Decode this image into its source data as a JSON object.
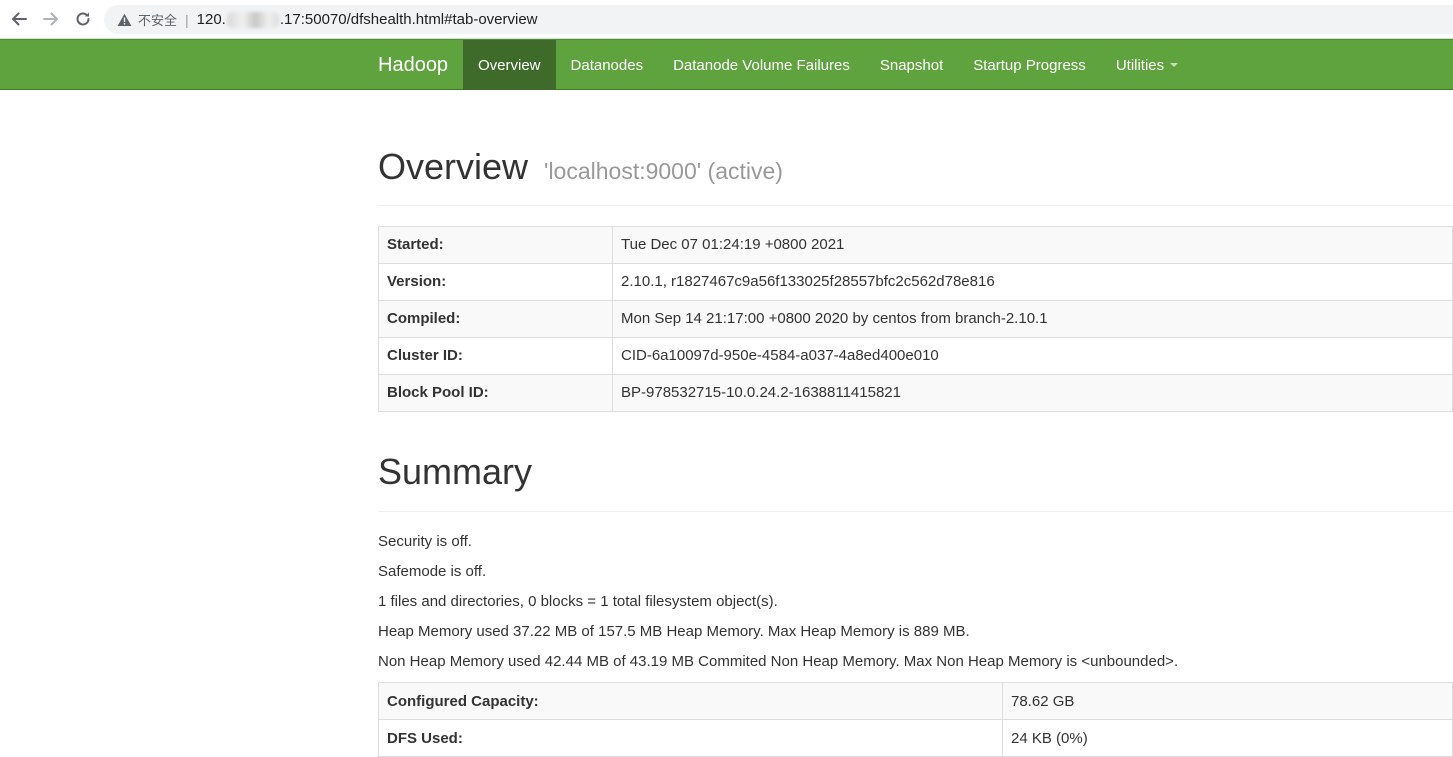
{
  "browser": {
    "insecure_label": "不安全",
    "url_prefix": "120.",
    "url_suffix": ".17:50070/dfshealth.html#tab-overview"
  },
  "navbar": {
    "brand": "Hadoop",
    "items": [
      {
        "label": "Overview",
        "active": true
      },
      {
        "label": "Datanodes"
      },
      {
        "label": "Datanode Volume Failures"
      },
      {
        "label": "Snapshot"
      },
      {
        "label": "Startup Progress"
      },
      {
        "label": "Utilities"
      }
    ]
  },
  "overview": {
    "title": "Overview",
    "subtitle": "'localhost:9000' (active)",
    "rows": [
      {
        "key": "Started:",
        "value": "Tue Dec 07 01:24:19 +0800 2021"
      },
      {
        "key": "Version:",
        "value": "2.10.1, r1827467c9a56f133025f28557bfc2c562d78e816"
      },
      {
        "key": "Compiled:",
        "value": "Mon Sep 14 21:17:00 +0800 2020 by centos from branch-2.10.1"
      },
      {
        "key": "Cluster ID:",
        "value": "CID-6a10097d-950e-4584-a037-4a8ed400e010"
      },
      {
        "key": "Block Pool ID:",
        "value": "BP-978532715-10.0.24.2-1638811415821"
      }
    ]
  },
  "summary": {
    "title": "Summary",
    "lines": [
      "Security is off.",
      "Safemode is off.",
      "1 files and directories, 0 blocks = 1 total filesystem object(s).",
      "Heap Memory used 37.22 MB of 157.5 MB Heap Memory. Max Heap Memory is 889 MB.",
      "Non Heap Memory used 42.44 MB of 43.19 MB Commited Non Heap Memory. Max Non Heap Memory is <unbounded>."
    ],
    "capacity_rows": [
      {
        "key": "Configured Capacity:",
        "value": "78.62 GB"
      },
      {
        "key": "DFS Used:",
        "value": "24 KB (0%)"
      }
    ]
  }
}
